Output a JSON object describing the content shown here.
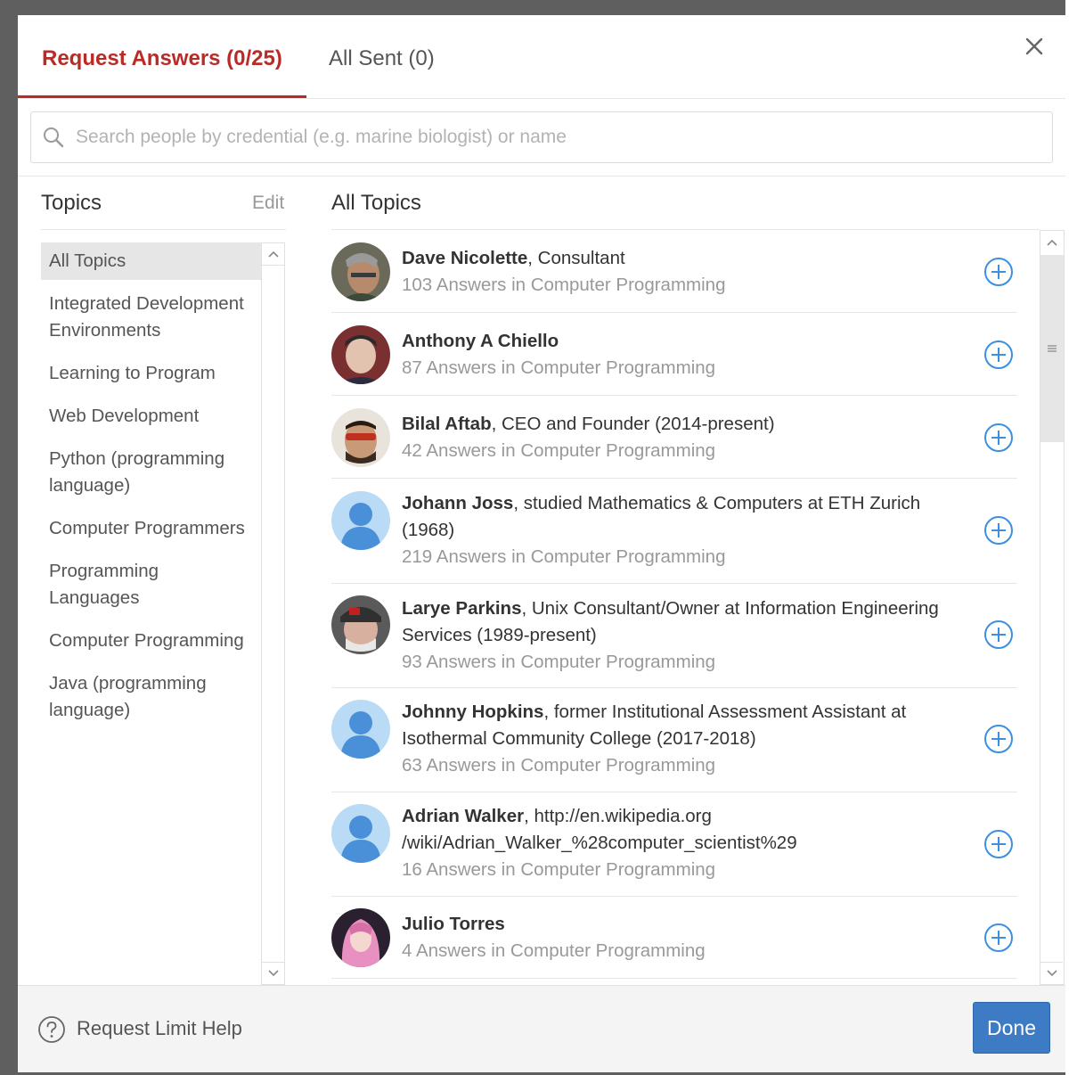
{
  "tabs": {
    "request_answers": "Request Answers (0/25)",
    "all_sent": "All Sent (0)"
  },
  "search": {
    "placeholder": "Search people by credential (e.g. marine biologist) or name"
  },
  "topics": {
    "title": "Topics",
    "edit": "Edit",
    "items": [
      "All Topics",
      "Integrated Development Environments",
      "Learning to Program",
      "Web Development",
      "Python (programming language)",
      "Computer Programmers",
      "Programming Languages",
      "Computer Programming",
      "Java (programming language)"
    ]
  },
  "people": {
    "title": "All Topics",
    "items": [
      {
        "name": "Dave Nicolette",
        "credential": ", Consultant",
        "answers": "103 Answers in Computer Programming"
      },
      {
        "name": "Anthony A Chiello",
        "credential": "",
        "answers": "87 Answers in Computer Programming"
      },
      {
        "name": "Bilal Aftab",
        "credential": ", CEO and Founder (2014-present)",
        "answers": "42 Answers in Computer Programming"
      },
      {
        "name": "Johann Joss",
        "credential": ", studied Mathematics & Computers at ETH Zurich (1968)",
        "answers": "219 Answers in Computer Programming"
      },
      {
        "name": "Larye Parkins",
        "credential": ", Unix Consultant/Owner at Information Engineering Services (1989-present)",
        "answers": "93 Answers in Computer Programming"
      },
      {
        "name": "Johnny Hopkins",
        "credential": ", former Institutional Assessment Assistant at Isothermal Community College (2017-2018)",
        "answers": "63 Answers in Computer Programming"
      },
      {
        "name": "Adrian Walker",
        "credential": ", http://en.wikipedia.org /wiki/Adrian_Walker_%28computer_scientist%29",
        "answers": "16 Answers in Computer Programming"
      },
      {
        "name": "Julio Torres",
        "credential": "",
        "answers": "4 Answers in Computer Programming"
      }
    ]
  },
  "footer": {
    "help": "Request Limit Help",
    "done": "Done"
  },
  "colors": {
    "accent_red": "#b92b27",
    "add_blue": "#3d8fe0",
    "done_blue": "#3d7bc4",
    "placeholder_avatar": "#b9dbf5"
  }
}
